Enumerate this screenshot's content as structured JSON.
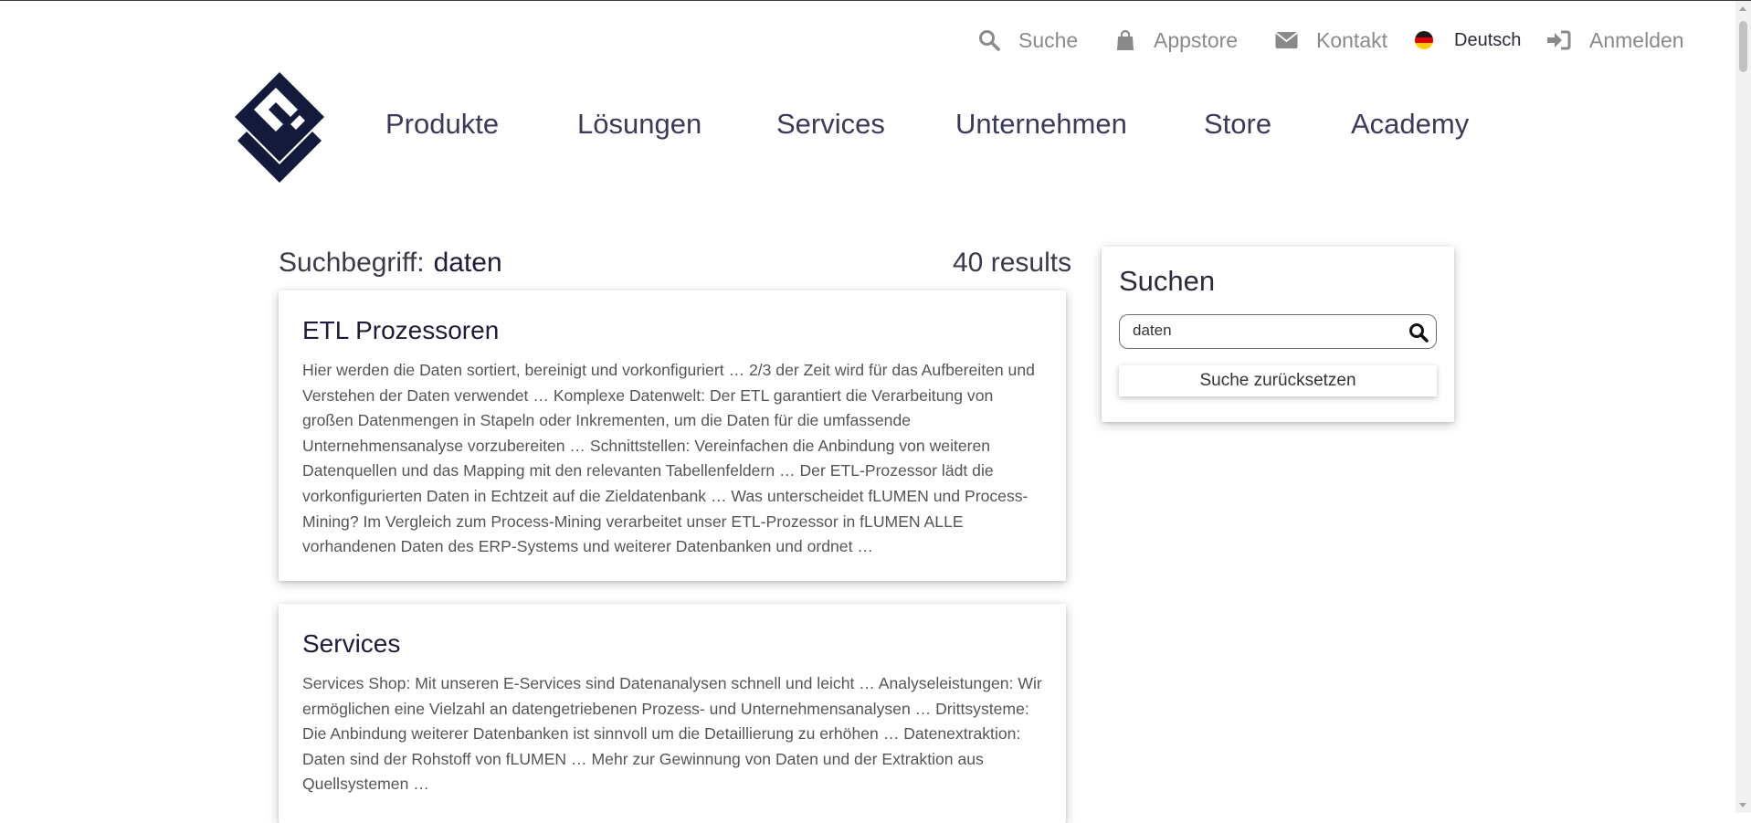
{
  "topbar": {
    "search_label": "Suche",
    "appstore_label": "Appstore",
    "contact_label": "Kontakt",
    "language_label": "Deutsch",
    "login_label": "Anmelden"
  },
  "nav": {
    "items": [
      "Produkte",
      "Lösungen",
      "Services",
      "Unternehmen",
      "Store",
      "Academy"
    ]
  },
  "search_header": {
    "label": "Suchbegriff:",
    "term": "daten",
    "count": "40 results"
  },
  "results": [
    {
      "title": "ETL Prozessoren",
      "snippet": "Hier werden die Daten sortiert, bereinigt und vorkonfiguriert … 2/3 der Zeit wird für das Aufbereiten und Verstehen der Daten verwendet … Komplexe Datenwelt: Der ETL garantiert die Verarbeitung von großen Datenmengen in Stapeln oder Inkrementen, um die Daten für die umfassende Unternehmensanalyse vorzubereiten … Schnittstellen: Vereinfachen die Anbindung von weiteren Datenquellen und das Mapping mit den relevanten Tabellenfeldern … Der ETL-Prozessor lädt die vorkonfigurierten Daten in Echtzeit auf die Zieldatenbank … Was unterscheidet fLUMEN und Process-Mining? Im Vergleich zum Process-Mining verarbeitet unser ETL-Prozessor in fLUMEN ALLE vorhandenen Daten des ERP-Systems und weiterer Datenbanken und ordnet …"
    },
    {
      "title": "Services",
      "snippet": "Services Shop: Mit unseren E-Services sind Datenanalysen schnell und leicht … Analyseleistungen: Wir ermöglichen eine Vielzahl an datengetriebenen Prozess- und Unternehmensanalysen … Drittsysteme: Die Anbindung weiterer Datenbanken ist sinnvoll um die Detaillierung zu erhöhen … Datenextraktion: Daten sind der Rohstoff von fLUMEN … Mehr zur Gewinnung von Daten und der Extraktion aus Quellsystemen …"
    }
  ],
  "sidebar": {
    "title": "Suchen",
    "input_value": "daten",
    "reset_label": "Suche zurücksetzen"
  },
  "colors": {
    "brand_navy": "#141a3c",
    "icon_gray": "#8a8a8a"
  },
  "icons": [
    "search-icon",
    "shopping-bag-icon",
    "envelope-icon",
    "german-flag-icon",
    "sign-in-icon",
    "logo-icon"
  ]
}
